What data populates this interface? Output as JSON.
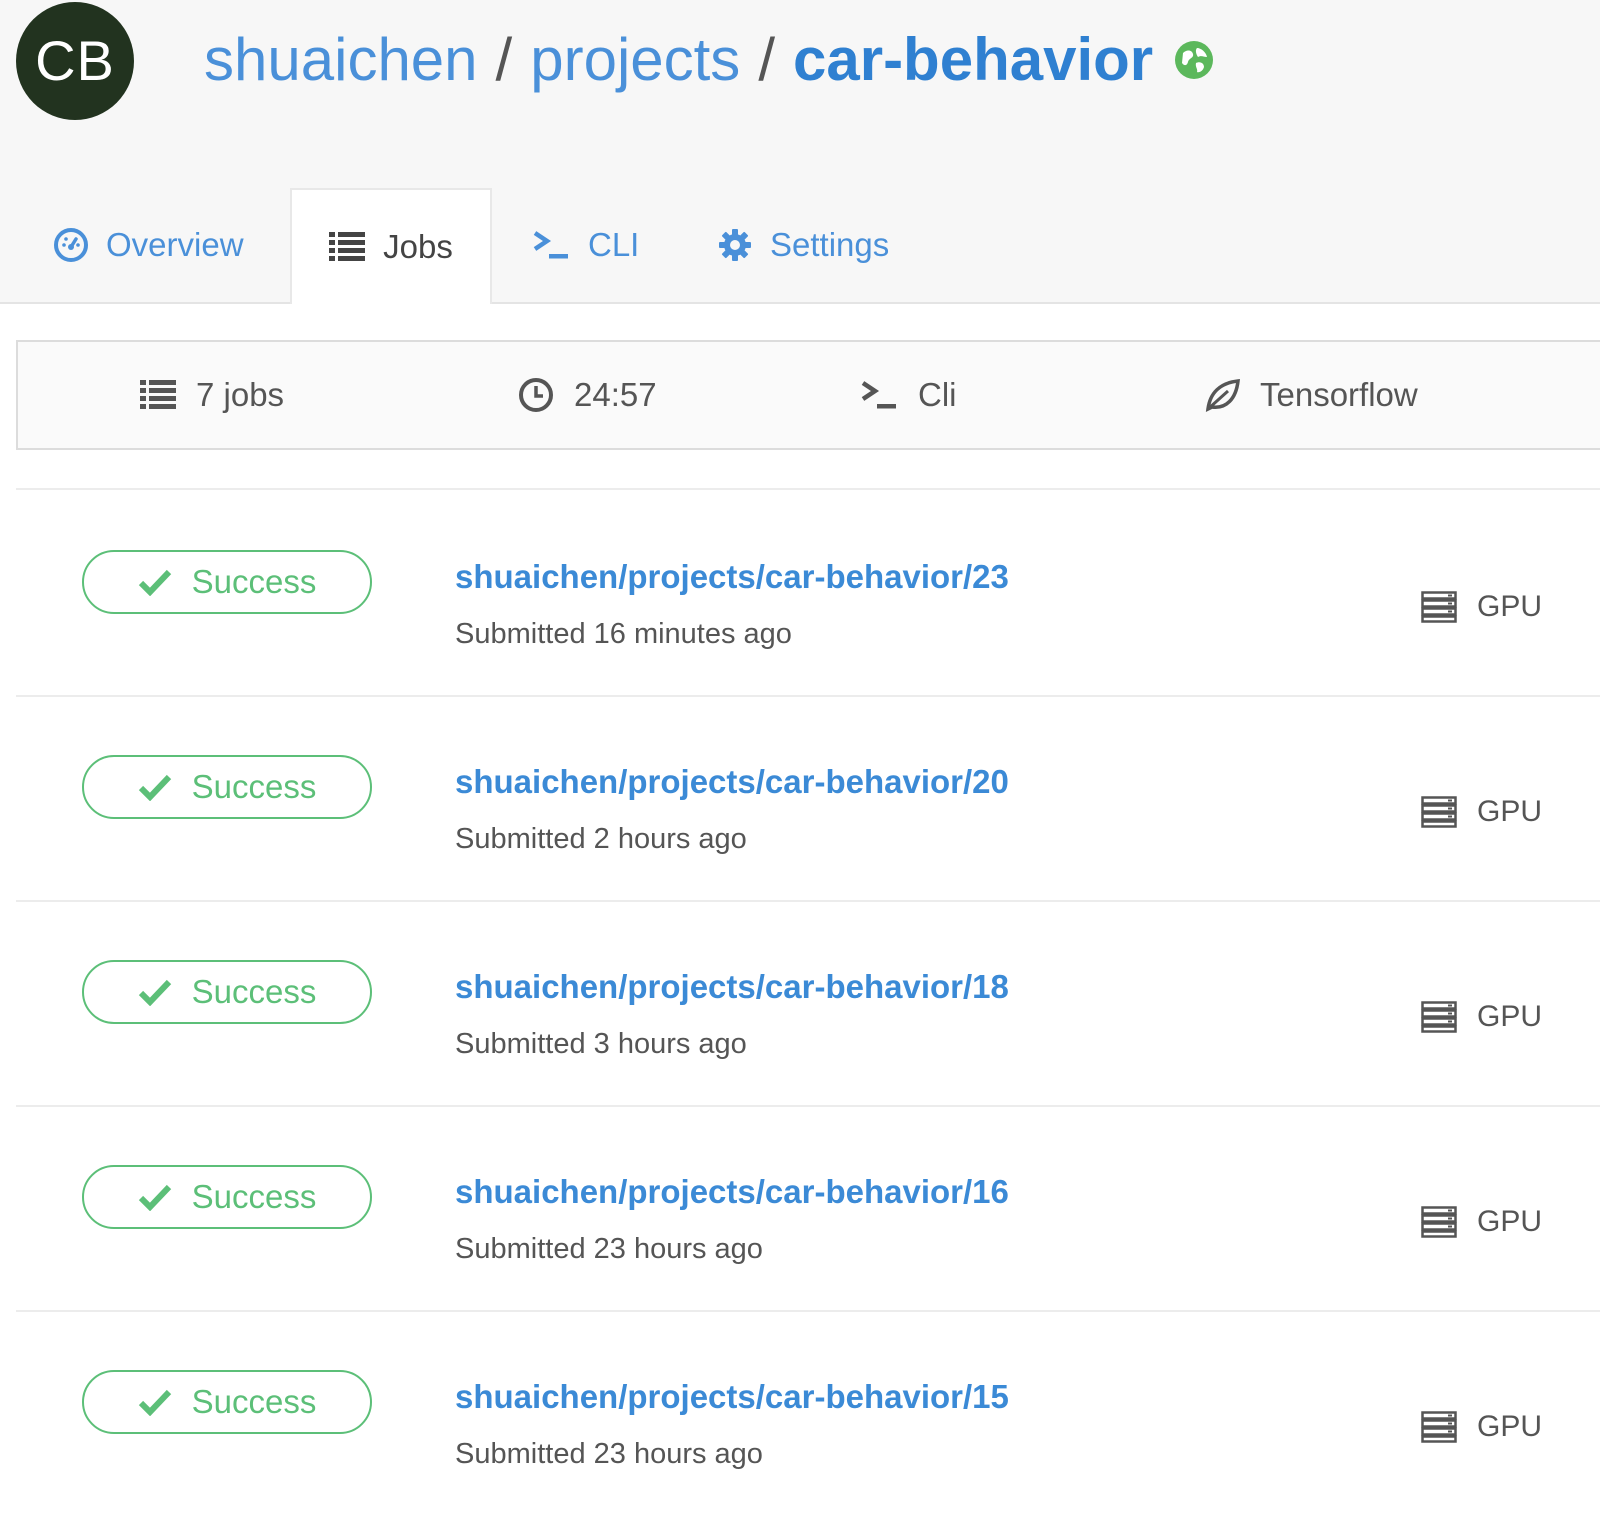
{
  "avatar": {
    "initials": "CB"
  },
  "breadcrumb": {
    "user": "shuaichen",
    "section": "projects",
    "project": "car-behavior",
    "separator": "/"
  },
  "colors": {
    "link": "#4a90d9",
    "success": "#5cbf78",
    "avatar_bg": "#22331f",
    "globe": "#5cb85c"
  },
  "tabs": [
    {
      "label": "Overview",
      "icon": "dashboard-icon",
      "active": false
    },
    {
      "label": "Jobs",
      "icon": "list-icon",
      "active": true
    },
    {
      "label": "CLI",
      "icon": "terminal-icon",
      "active": false
    },
    {
      "label": "Settings",
      "icon": "gear-icon",
      "active": false
    }
  ],
  "stats": {
    "jobs": "7 jobs",
    "duration": "24:57",
    "source": "Cli",
    "framework": "Tensorflow"
  },
  "jobs": [
    {
      "status": "Success",
      "title": "shuaichen/projects/car-behavior/23",
      "submitted": "Submitted 16 minutes ago",
      "machine": "GPU"
    },
    {
      "status": "Success",
      "title": "shuaichen/projects/car-behavior/20",
      "submitted": "Submitted 2 hours ago",
      "machine": "GPU"
    },
    {
      "status": "Success",
      "title": "shuaichen/projects/car-behavior/18",
      "submitted": "Submitted 3 hours ago",
      "machine": "GPU"
    },
    {
      "status": "Success",
      "title": "shuaichen/projects/car-behavior/16",
      "submitted": "Submitted 23 hours ago",
      "machine": "GPU"
    },
    {
      "status": "Success",
      "title": "shuaichen/projects/car-behavior/15",
      "submitted": "Submitted 23 hours ago",
      "machine": "GPU"
    }
  ]
}
